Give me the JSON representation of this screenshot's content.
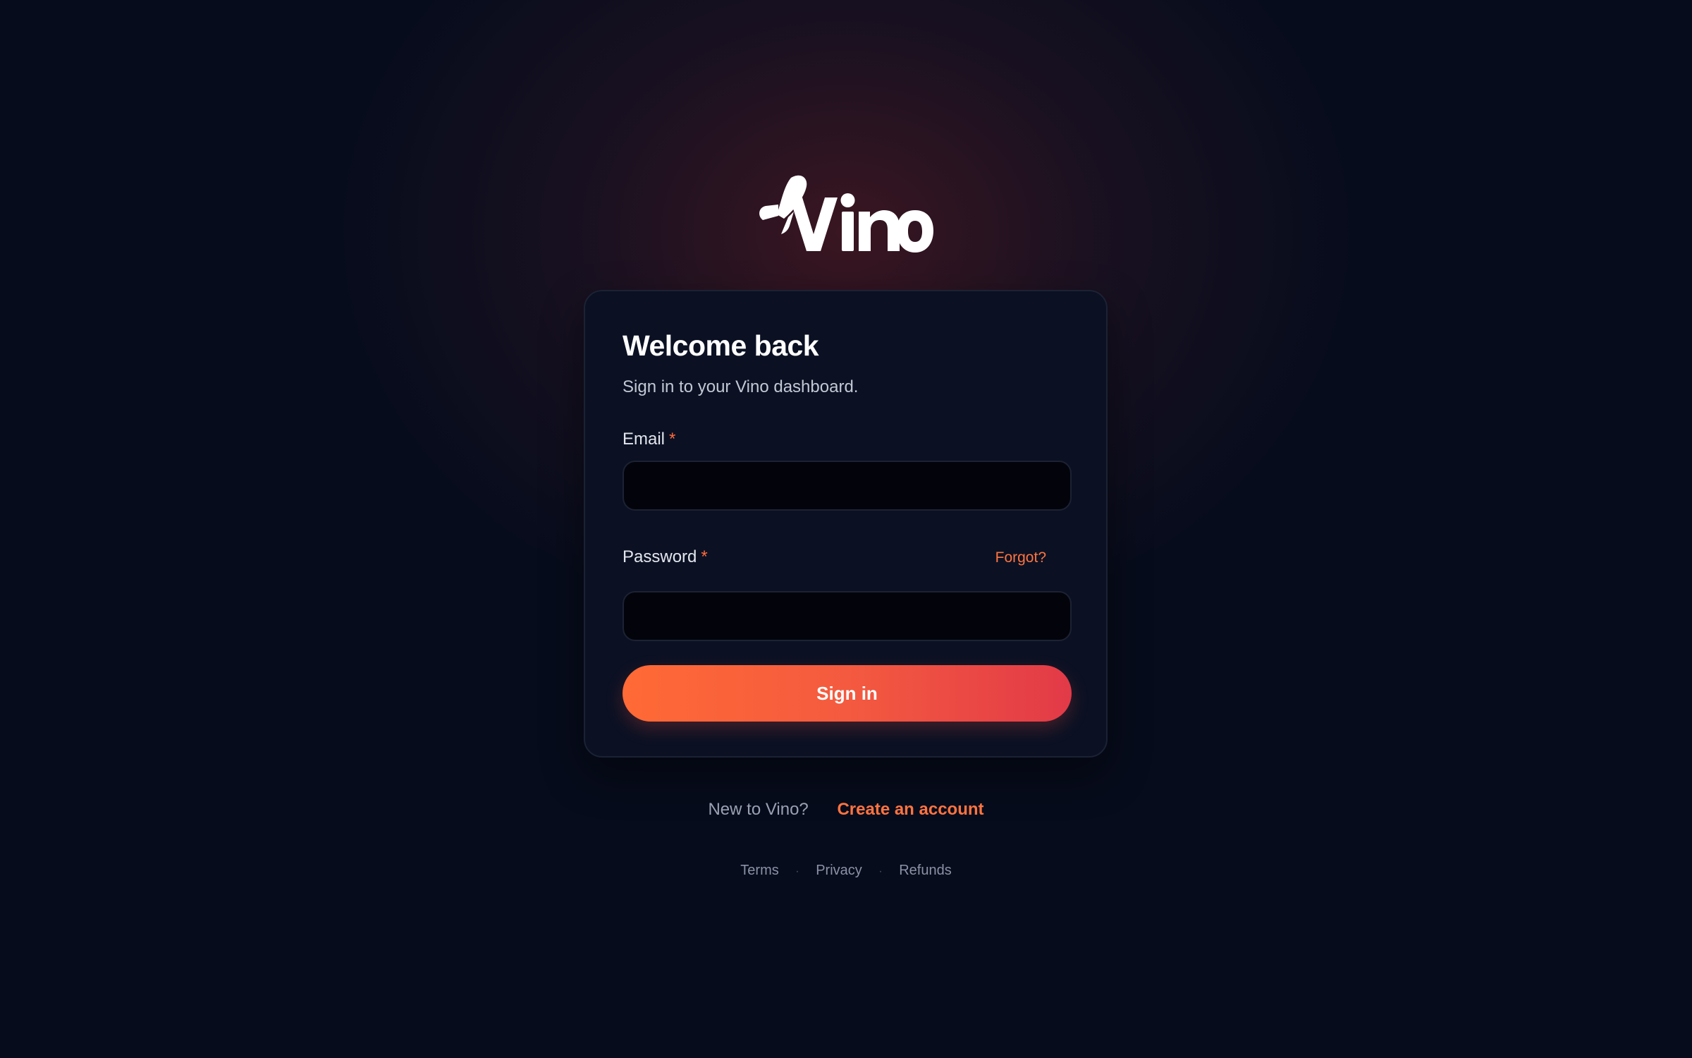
{
  "brand": {
    "name": "Vino",
    "logo_icon": "rocket-icon",
    "accent_color": "#ff6a36",
    "accent_color_end": "#e23a48"
  },
  "card": {
    "title": "Welcome back",
    "subtitle": "Sign in to your Vino dashboard.",
    "email": {
      "label": "Email",
      "required_marker": "*",
      "value": "",
      "placeholder": ""
    },
    "password": {
      "label": "Password",
      "required_marker": "*",
      "value": "",
      "placeholder": "",
      "forgot_label": "Forgot?"
    },
    "submit_label": "Sign in"
  },
  "signup": {
    "question": "New to Vino?",
    "link_label": "Create an account"
  },
  "footer": {
    "links": [
      "Terms",
      "Privacy",
      "Refunds"
    ],
    "separator": "·"
  }
}
